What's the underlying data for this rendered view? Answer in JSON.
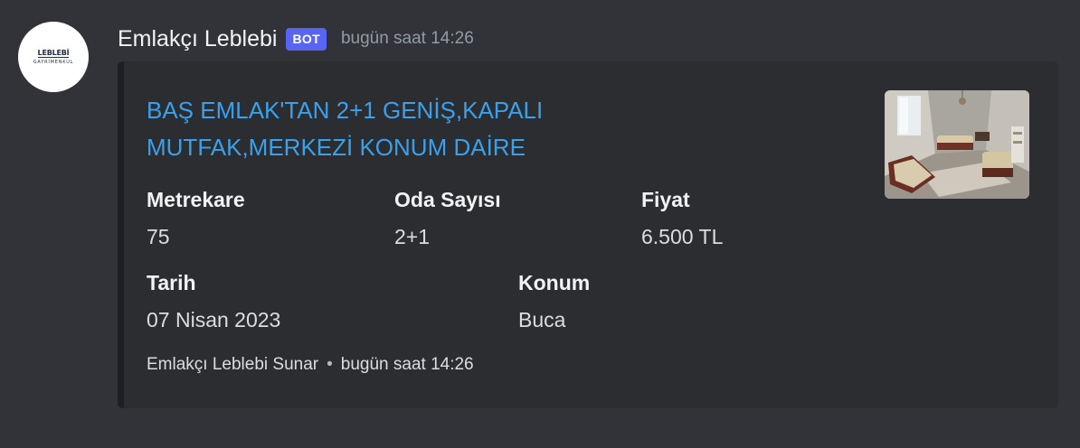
{
  "author": {
    "avatar_text_top": "LEBLEBİ",
    "avatar_text_bottom": "GAYRİMENKUL",
    "name": "Emlakçı Leblebi",
    "badge": "BOT",
    "timestamp": "bugün saat 14:26"
  },
  "embed": {
    "title_line1": "BAŞ EMLAK'TAN 2+1 GENİŞ,KAPALI",
    "title_line2": "MUTFAK,MERKEZİ KONUM DAİRE",
    "thumbnail": "living-room-photo",
    "fields": [
      {
        "name": "Metrekare",
        "value": "75"
      },
      {
        "name": "Oda Sayısı",
        "value": "2+1"
      },
      {
        "name": "Fiyat",
        "value": "6.500 TL"
      },
      {
        "name": "Tarih",
        "value": "07 Nisan 2023"
      },
      {
        "name": "Konum",
        "value": "Buca"
      }
    ],
    "footer": {
      "text": "Emlakçı Leblebi Sunar",
      "separator": "•",
      "timestamp": "bugün saat 14:26"
    }
  },
  "colors": {
    "background": "#313338",
    "embed_background": "#2b2d31",
    "title_link": "#3ba0ea",
    "bot_badge": "#5865f2"
  }
}
